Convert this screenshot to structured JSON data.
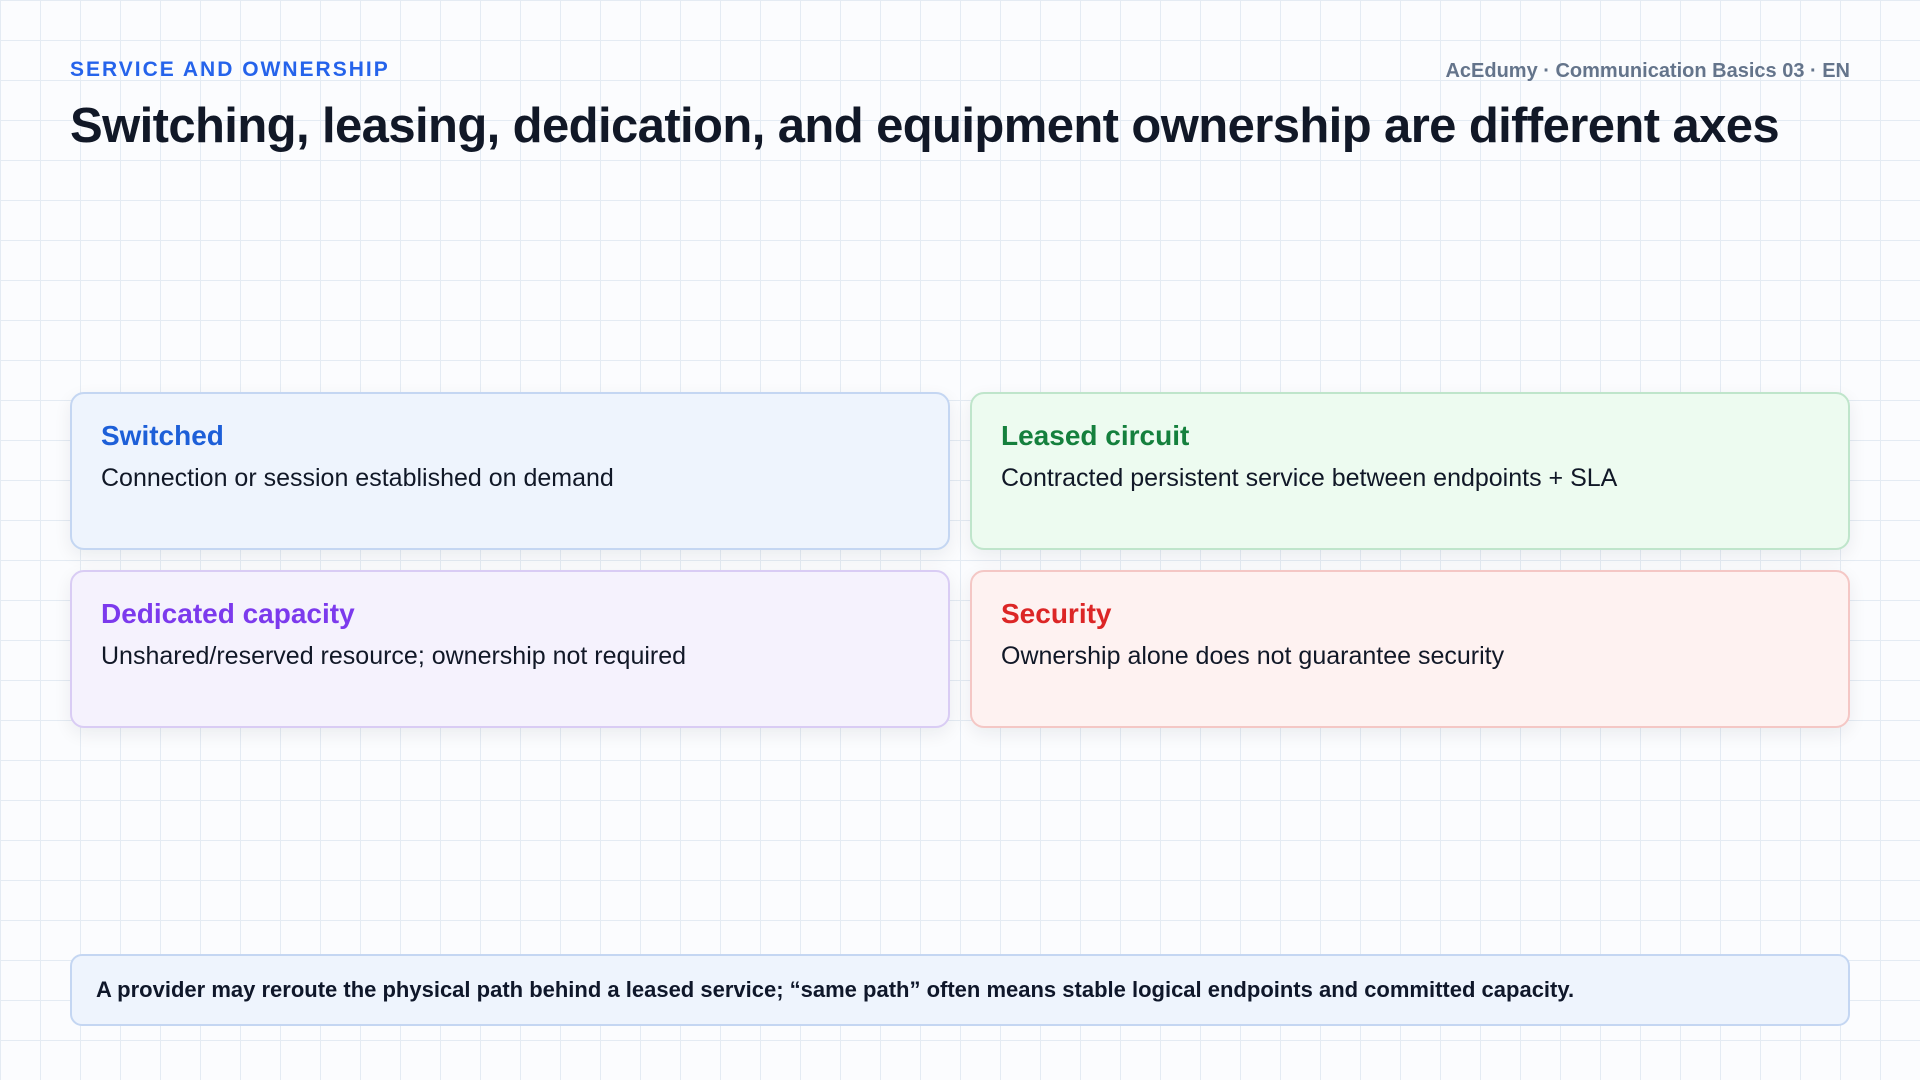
{
  "header": {
    "eyebrow": "SERVICE AND OWNERSHIP",
    "meta": "AcEdumy · Communication Basics 03 · EN",
    "title": "Switching, leasing, dedication, and equipment ownership are different axes"
  },
  "cards": [
    {
      "title": "Switched",
      "body": "Connection or session established on demand",
      "accent": "#1d5fd8"
    },
    {
      "title": "Leased circuit",
      "body": "Contracted persistent service between endpoints + SLA",
      "accent": "#15803d"
    },
    {
      "title": "Dedicated capacity",
      "body": "Unshared/reserved resource; ownership not required",
      "accent": "#7c3aed"
    },
    {
      "title": "Security",
      "body": "Ownership alone does not guarantee security",
      "accent": "#dc2626"
    }
  ],
  "note": {
    "text": "A provider may reroute the physical path behind a leased service; “same path” often means stable logical endpoints and committed capacity."
  }
}
